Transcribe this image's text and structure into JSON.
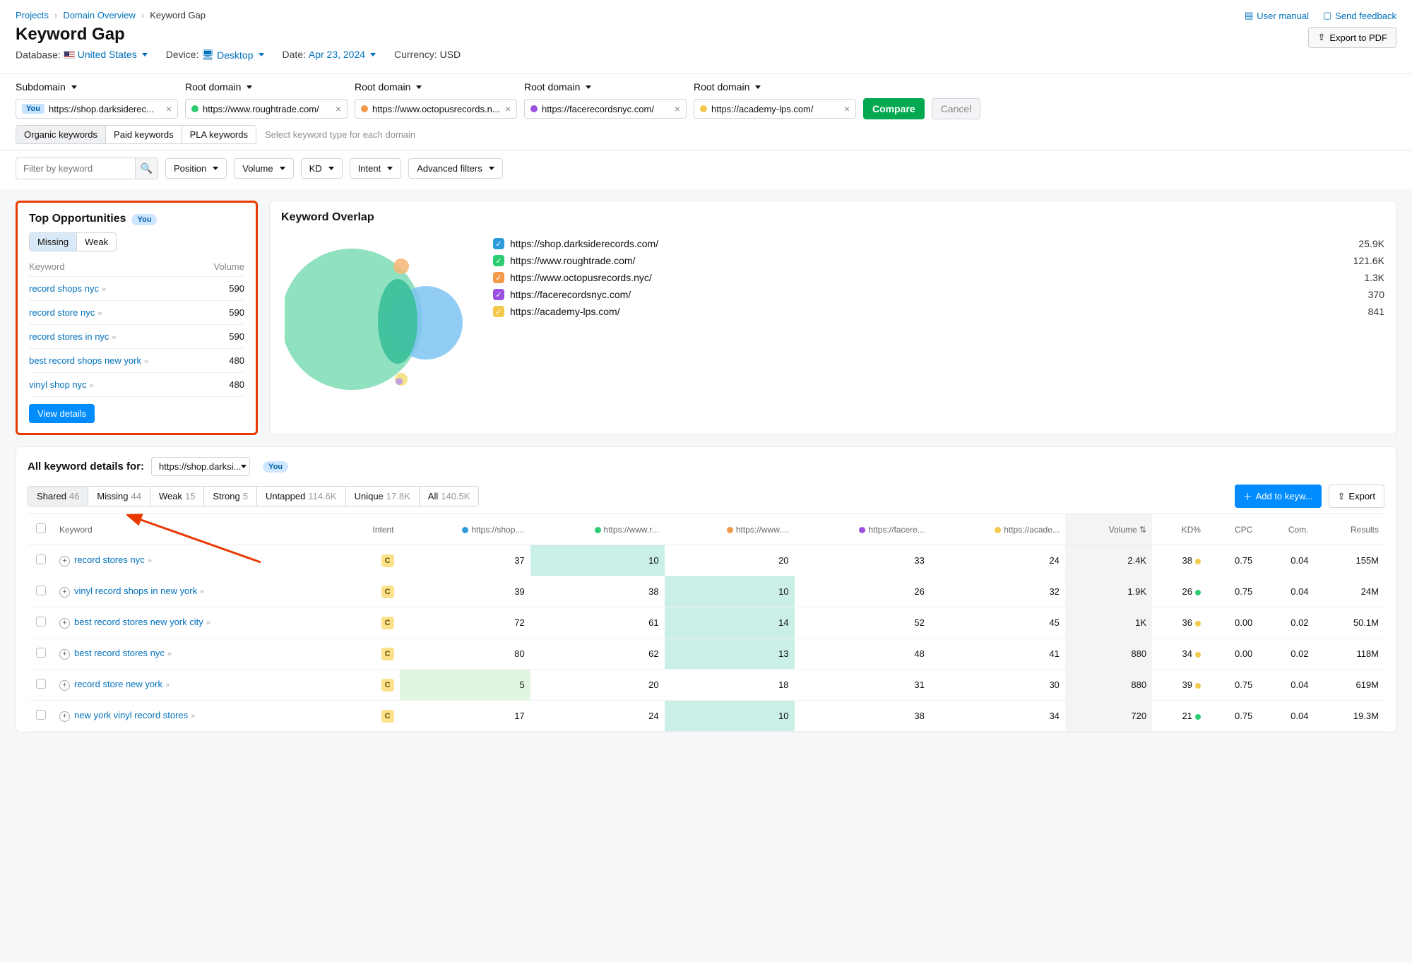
{
  "breadcrumb": {
    "a": "Projects",
    "b": "Domain Overview",
    "c": "Keyword Gap"
  },
  "page_title": "Keyword Gap",
  "header_links": {
    "manual": "User manual",
    "feedback": "Send feedback",
    "export": "Export to PDF"
  },
  "params": {
    "db_label": "Database:",
    "db_value": "United States",
    "device_label": "Device:",
    "device_value": "Desktop",
    "date_label": "Date:",
    "date_value": "Apr 23, 2024",
    "currency_label": "Currency:",
    "currency_value": "USD"
  },
  "domain_types": [
    "Subdomain",
    "Root domain",
    "Root domain",
    "Root domain",
    "Root domain"
  ],
  "domains": [
    {
      "you": true,
      "color": "#2d9cdb",
      "text": "https://shop.darksiderec..."
    },
    {
      "you": false,
      "color": "#2ecc71",
      "text": "https://www.roughtrade.com/"
    },
    {
      "you": false,
      "color": "#f2994a",
      "text": "https://www.octopusrecords.n..."
    },
    {
      "you": false,
      "color": "#9b51e0",
      "text": "https://facerecordsnyc.com/"
    },
    {
      "you": false,
      "color": "#f2c94c",
      "text": "https://academy-lps.com/"
    }
  ],
  "compare": "Compare",
  "cancel": "Cancel",
  "kw_types": {
    "organic": "Organic keywords",
    "paid": "Paid keywords",
    "pla": "PLA keywords",
    "hint": "Select keyword type for each domain"
  },
  "filters": {
    "placeholder": "Filter by keyword",
    "position": "Position",
    "volume": "Volume",
    "kd": "KD",
    "intent": "Intent",
    "adv": "Advanced filters"
  },
  "opp": {
    "title": "Top Opportunities",
    "you": "You",
    "tab_missing": "Missing",
    "tab_weak": "Weak",
    "col_kw": "Keyword",
    "col_vol": "Volume",
    "rows": [
      {
        "kw": "record shops nyc",
        "vol": "590"
      },
      {
        "kw": "record store nyc",
        "vol": "590"
      },
      {
        "kw": "record stores in nyc",
        "vol": "590"
      },
      {
        "kw": "best record shops new york",
        "vol": "480"
      },
      {
        "kw": "vinyl shop nyc",
        "vol": "480"
      }
    ],
    "view": "View details"
  },
  "overlap": {
    "title": "Keyword Overlap",
    "legend": [
      {
        "color": "#2d9cdb",
        "label": "https://shop.darksiderecords.com/",
        "val": "25.9K"
      },
      {
        "color": "#2ecc71",
        "label": "https://www.roughtrade.com/",
        "val": "121.6K"
      },
      {
        "color": "#f2994a",
        "label": "https://www.octopusrecords.nyc/",
        "val": "1.3K"
      },
      {
        "color": "#9b51e0",
        "label": "https://facerecordsnyc.com/",
        "val": "370"
      },
      {
        "color": "#f2c94c",
        "label": "https://academy-lps.com/",
        "val": "841"
      }
    ]
  },
  "chart_data": {
    "type": "venn",
    "title": "Keyword Overlap",
    "sets": [
      {
        "name": "https://shop.darksiderecords.com/",
        "size": 25900,
        "color": "#2d9cdb"
      },
      {
        "name": "https://www.roughtrade.com/",
        "size": 121600,
        "color": "#2ecc71"
      },
      {
        "name": "https://www.octopusrecords.nyc/",
        "size": 1300,
        "color": "#f2994a"
      },
      {
        "name": "https://facerecordsnyc.com/",
        "size": 370,
        "color": "#9b51e0"
      },
      {
        "name": "https://academy-lps.com/",
        "size": 841,
        "color": "#f2c94c"
      }
    ]
  },
  "details": {
    "title": "All keyword details for:",
    "domain": "https://shop.darksi...",
    "you": "You",
    "tabs": [
      {
        "n": "Shared",
        "c": "46",
        "active": true
      },
      {
        "n": "Missing",
        "c": "44"
      },
      {
        "n": "Weak",
        "c": "15"
      },
      {
        "n": "Strong",
        "c": "5"
      },
      {
        "n": "Untapped",
        "c": "114.6K"
      },
      {
        "n": "Unique",
        "c": "17.8K"
      },
      {
        "n": "All",
        "c": "140.5K"
      }
    ],
    "add": "Add to keyw...",
    "export": "Export",
    "cols": {
      "kw": "Keyword",
      "intent": "Intent",
      "d0": "https://shop....",
      "d1": "https://www.r...",
      "d2": "https://www....",
      "d3": "https://facere...",
      "d4": "https://acade...",
      "vol": "Volume",
      "kd": "KD%",
      "cpc": "CPC",
      "com": "Com.",
      "res": "Results"
    },
    "rows": [
      {
        "kw": "record stores nyc",
        "intent": "C",
        "p": [
          "37",
          "10",
          "20",
          "33",
          "24"
        ],
        "best": 1,
        "vol": "2.4K",
        "kd": "38",
        "kdc": "#f2c94c",
        "cpc": "0.75",
        "com": "0.04",
        "res": "155M"
      },
      {
        "kw": "vinyl record shops in new york",
        "intent": "C",
        "p": [
          "39",
          "38",
          "10",
          "26",
          "32"
        ],
        "best": 2,
        "vol": "1.9K",
        "kd": "26",
        "kdc": "#2ecc71",
        "cpc": "0.75",
        "com": "0.04",
        "res": "24M"
      },
      {
        "kw": "best record stores new york city",
        "intent": "C",
        "p": [
          "72",
          "61",
          "14",
          "52",
          "45"
        ],
        "best": 2,
        "vol": "1K",
        "kd": "36",
        "kdc": "#f2c94c",
        "cpc": "0.00",
        "com": "0.02",
        "res": "50.1M"
      },
      {
        "kw": "best record stores nyc",
        "intent": "C",
        "p": [
          "80",
          "62",
          "13",
          "48",
          "41"
        ],
        "best": 2,
        "vol": "880",
        "kd": "34",
        "kdc": "#f2c94c",
        "cpc": "0.00",
        "com": "0.02",
        "res": "118M"
      },
      {
        "kw": "record store new york",
        "intent": "C",
        "p": [
          "5",
          "20",
          "18",
          "31",
          "30"
        ],
        "best": 0,
        "vol": "880",
        "kd": "39",
        "kdc": "#f2c94c",
        "cpc": "0.75",
        "com": "0.04",
        "res": "619M"
      },
      {
        "kw": "new york vinyl record stores",
        "intent": "C",
        "p": [
          "17",
          "24",
          "10",
          "38",
          "34"
        ],
        "best": 2,
        "vol": "720",
        "kd": "21",
        "kdc": "#2ecc71",
        "cpc": "0.75",
        "com": "0.04",
        "res": "19.3M"
      }
    ]
  }
}
